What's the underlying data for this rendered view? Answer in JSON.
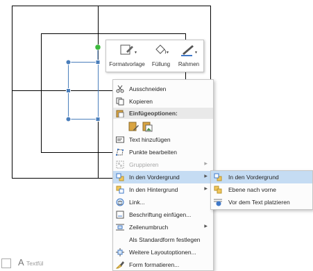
{
  "mini_toolbar": {
    "buttons": [
      {
        "label": "Formatvorlage",
        "icon": "shape-style-icon"
      },
      {
        "label": "Füllung",
        "icon": "paint-bucket-icon"
      },
      {
        "label": "Rahmen",
        "icon": "pen-outline-icon"
      }
    ]
  },
  "context_menu": {
    "items": [
      {
        "label": "Ausschneiden",
        "icon": "scissors-icon",
        "enabled": true
      },
      {
        "label": "Kopieren",
        "icon": "copy-icon",
        "enabled": true
      },
      {
        "label": "Einfügeoptionen:",
        "icon": "clipboard-icon",
        "header": true
      },
      {
        "label": "Text hinzufügen",
        "icon": "text-box-icon",
        "enabled": true
      },
      {
        "label": "Punkte bearbeiten",
        "icon": "edit-points-icon",
        "enabled": true
      },
      {
        "label": "Gruppieren",
        "icon": "group-icon",
        "enabled": false,
        "submenu": true
      },
      {
        "label": "In den Vordergrund",
        "icon": "bring-forward-icon",
        "enabled": true,
        "submenu": true,
        "highlighted": true
      },
      {
        "label": "In den Hintergrund",
        "icon": "send-backward-icon",
        "enabled": true,
        "submenu": true
      },
      {
        "label": "Link...",
        "icon": "link-icon",
        "enabled": true
      },
      {
        "label": "Beschriftung einfügen...",
        "icon": "caption-icon",
        "enabled": true
      },
      {
        "label": "Zeilenumbruch",
        "icon": "wrap-text-icon",
        "enabled": true,
        "submenu": true
      },
      {
        "label": "Als Standardform festlegen",
        "icon": "",
        "enabled": true
      },
      {
        "label": "Weitere Layoutoptionen...",
        "icon": "layout-options-icon",
        "enabled": true
      },
      {
        "label": "Form formatieren...",
        "icon": "format-shape-icon",
        "enabled": true
      }
    ]
  },
  "submenu": {
    "items": [
      {
        "label": "In den Vordergrund",
        "icon": "bring-to-front-icon",
        "highlighted": true
      },
      {
        "label": "Ebene nach vorne",
        "icon": "bring-forward-icon"
      },
      {
        "label": "Vor dem Text platzieren",
        "icon": "in-front-of-text-icon"
      }
    ]
  },
  "textfield": {
    "label": "Textfül"
  },
  "colors": {
    "highlight": "#c5dcf3",
    "handle": "#4a7ebb",
    "rotate_handle": "#3cb93c"
  }
}
